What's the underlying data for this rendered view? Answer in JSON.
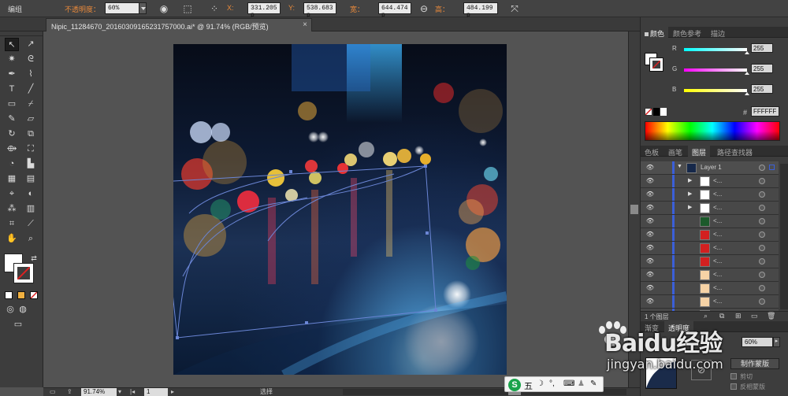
{
  "control_bar": {
    "group_label": "编组",
    "opacity_label": "不透明度：",
    "opacity_value": "60%",
    "x_label": "X:",
    "x_value": "331.205 p",
    "y_label": "Y:",
    "y_value": "538.683 p",
    "w_label": "宽：",
    "w_value": "644.474 p",
    "h_label": "高：",
    "h_value": "484.199 p"
  },
  "document_tab": {
    "title": "Nipic_11284670_20160309165231757000.ai* @ 91.74% (RGB/预览)",
    "close": "×"
  },
  "color_panel": {
    "tabs": [
      "颜色",
      "颜色参考",
      "描边"
    ],
    "r_label": "R",
    "r_value": "255",
    "g_label": "G",
    "g_value": "255",
    "b_label": "B",
    "b_value": "255",
    "hex_label": "#",
    "hex_value": "FFFFFF"
  },
  "layers_panel": {
    "tabs": [
      "色板",
      "画笔",
      "图层",
      "路径查找器"
    ],
    "layer_name": "Layer 1",
    "sublayer_label": "<...",
    "footer_count": "1 个图层"
  },
  "transparency_panel": {
    "tabs": [
      "渐变",
      "透明度"
    ],
    "opacity_value": "60%",
    "make_mask_button": "制作蒙版",
    "clip_label": "剪切",
    "invert_mask_label": "反相蒙版"
  },
  "status_bar": {
    "zoom": "91.74%",
    "page": "1",
    "mode": "选择"
  },
  "ime_bar": {
    "items": [
      "S",
      "五",
      "☽",
      "°,",
      "⌨",
      "♟",
      "✎"
    ]
  },
  "watermark": {
    "brand": "Baidu经验",
    "url": "jingyan.baidu.com"
  },
  "colors": {
    "ui_bg": "#535353",
    "panel": "#3d3d3d",
    "selection_blue": "#3b5fd9",
    "orange_label": "#e8893b"
  }
}
